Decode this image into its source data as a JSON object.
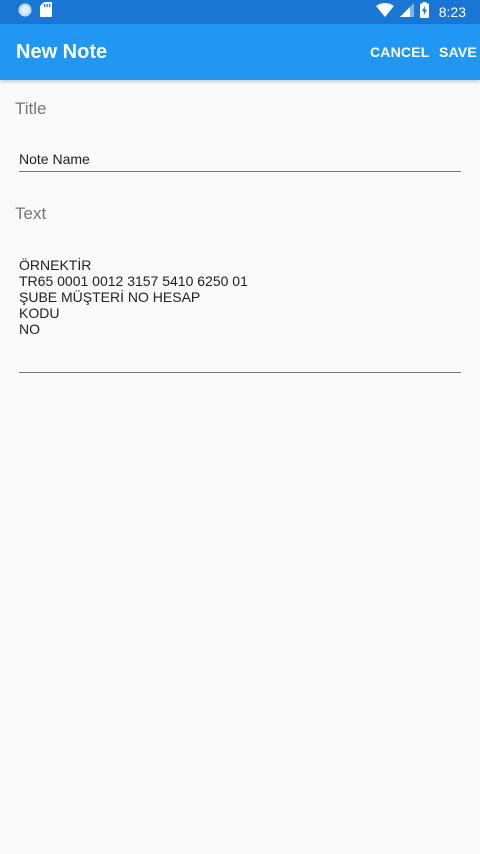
{
  "status_bar": {
    "time": "8:23",
    "left_icons": [
      "circle-notification-icon",
      "sd-card-icon"
    ],
    "right_icons": [
      "wifi-icon",
      "cell-signal-icon",
      "battery-charging-icon"
    ]
  },
  "app_bar": {
    "title": "New Note",
    "cancel_label": "CANCEL",
    "save_label": "SAVE"
  },
  "form": {
    "title_label": "Title",
    "title_value": "Note Name",
    "text_label": "Text",
    "text_lines": [
      "ÖRNEKTİR",
      "TR65 0001 0012 3157 5410 6250 01",
      "ŞUBE MÜŞTERİ NO HESAP",
      "KODU",
      "NO"
    ]
  },
  "colors": {
    "status_bar": "#1976d2",
    "app_bar": "#2196f3",
    "background": "#fafafa",
    "label": "#757575",
    "text": "#212121"
  }
}
